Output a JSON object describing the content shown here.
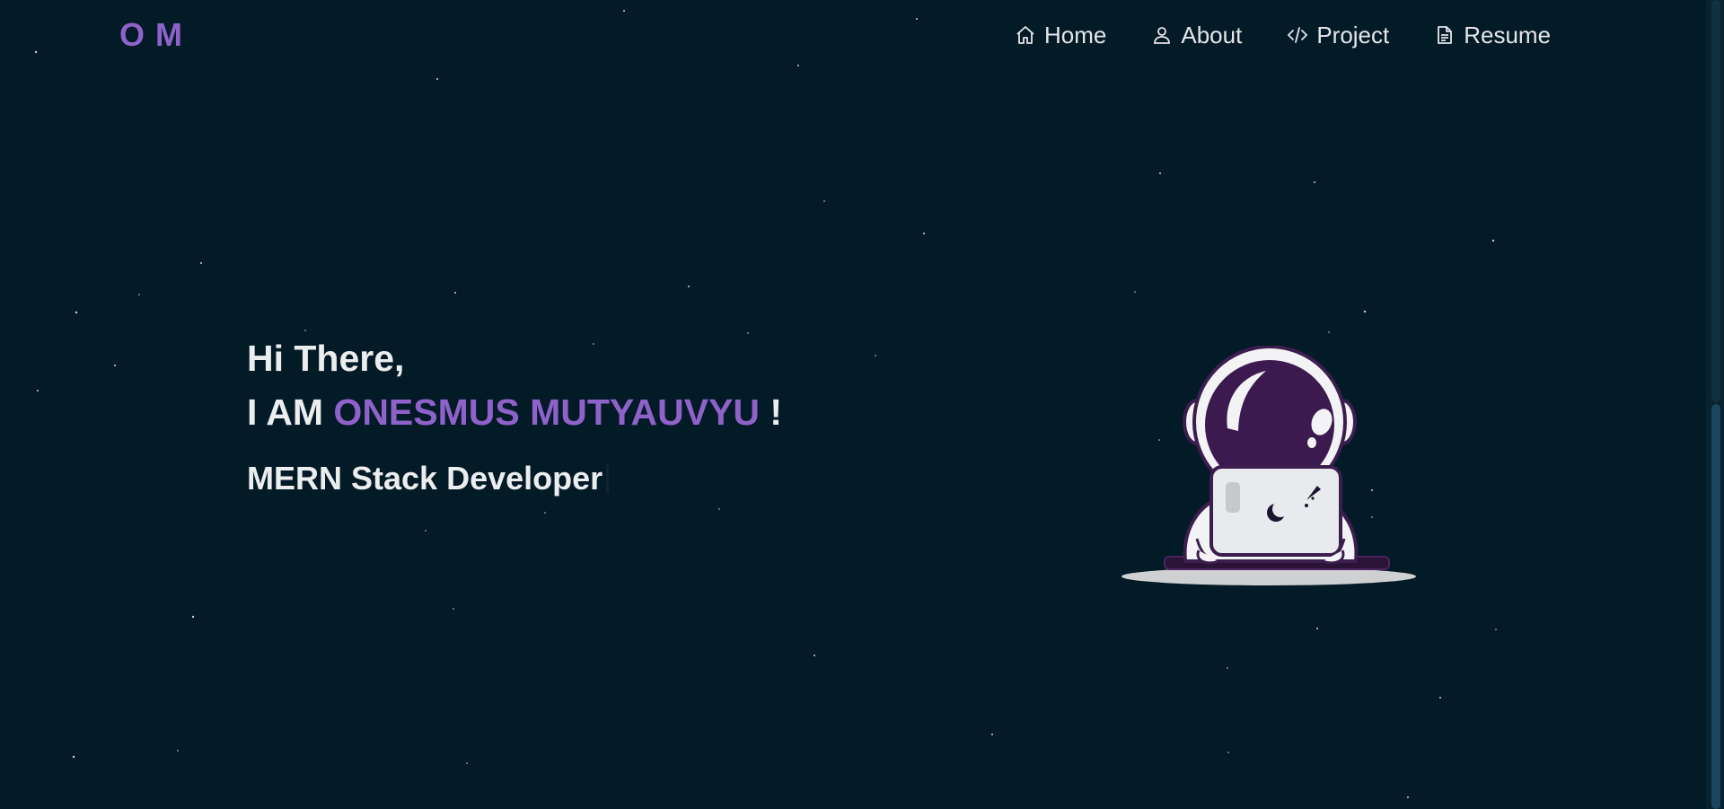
{
  "navbar": {
    "logo": "O M",
    "links": [
      {
        "label": "Home",
        "icon": "home-icon"
      },
      {
        "label": "About",
        "icon": "user-icon"
      },
      {
        "label": "Project",
        "icon": "code-icon"
      },
      {
        "label": "Resume",
        "icon": "document-icon"
      }
    ]
  },
  "hero": {
    "greeting": "Hi There,",
    "name_prefix": "I AM ",
    "name": "ONESMUS MUTYAUVYU",
    "name_suffix": " !",
    "role": "MERN Stack Developer"
  },
  "colors": {
    "background": "#031a27",
    "accent": "#8f62c9",
    "text": "#ecedee"
  },
  "illustration": "astronaut-with-laptop"
}
